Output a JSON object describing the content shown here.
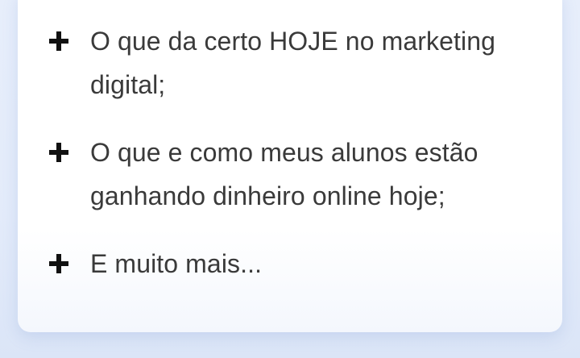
{
  "features": {
    "items": [
      {
        "text": "O que da certo HOJE no marketing digital;",
        "icon": "plus-icon"
      },
      {
        "text": "O que e como meus alunos estão ganhando dinheiro online hoje;",
        "icon": "plus-icon"
      },
      {
        "text": "E muito mais...",
        "icon": "plus-icon"
      }
    ]
  },
  "colors": {
    "background": "#e5ecfa",
    "card": "#ffffff",
    "text": "#3a3a3a",
    "icon": "#111111"
  }
}
